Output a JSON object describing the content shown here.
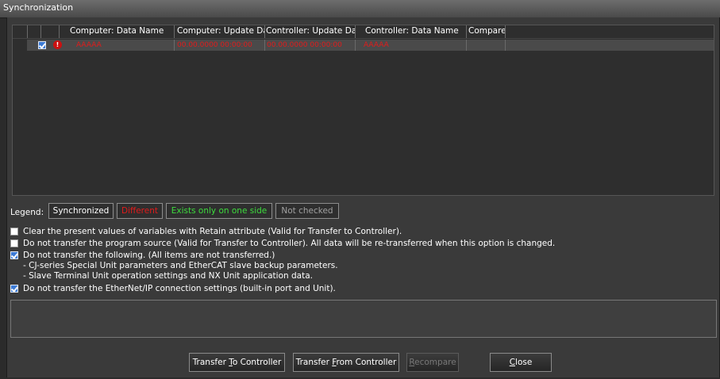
{
  "window": {
    "title": "Synchronization"
  },
  "grid": {
    "columns": [
      "Computer: Data Name",
      "Computer: Update Da",
      "Controller: Update Da",
      "Controller: Data Name",
      "Compare"
    ],
    "rows": [
      {
        "checked": true,
        "status": "!",
        "computer_name": "AAAAA",
        "computer_update": "00.00.0000 00:00:00",
        "controller_update": "00.00.0000 00:00:00",
        "controller_name": "AAAAA",
        "compare": ""
      }
    ]
  },
  "legend": {
    "label": "Legend:",
    "items": [
      {
        "label": "Synchronized",
        "color": "#ffffff"
      },
      {
        "label": "Different",
        "color": "#e21b1b"
      },
      {
        "label": "Exists only on one side",
        "color": "#3ddc3d"
      },
      {
        "label": "Not checked",
        "color": "#a0a0a0"
      }
    ]
  },
  "options": [
    {
      "checked": false,
      "lines": [
        "Clear the present values of variables with Retain attribute (Valid for Transfer to Controller)."
      ]
    },
    {
      "checked": false,
      "lines": [
        "Do not transfer the program source (Valid for Transfer to Controller). All data will be re-transferred when this option is changed."
      ]
    },
    {
      "checked": true,
      "lines": [
        "Do not transfer the following. (All items are not transferred.)",
        "- CJ-series Special Unit parameters and EtherCAT slave backup parameters.",
        "- Slave Terminal Unit operation settings and NX Unit application data."
      ]
    },
    {
      "checked": true,
      "lines": [
        "Do not transfer the EtherNet/IP connection settings (built-in port and Unit)."
      ]
    }
  ],
  "buttons": {
    "transfer_to": {
      "pre": "Transfer ",
      "key": "T",
      "post": "o Controller"
    },
    "transfer_from": {
      "pre": "Transfer ",
      "key": "F",
      "post": "rom Controller"
    },
    "recompare": {
      "pre": "",
      "key": "R",
      "post": "ecompare",
      "disabled": true
    },
    "close": {
      "pre": "",
      "key": "C",
      "post": "lose"
    }
  }
}
